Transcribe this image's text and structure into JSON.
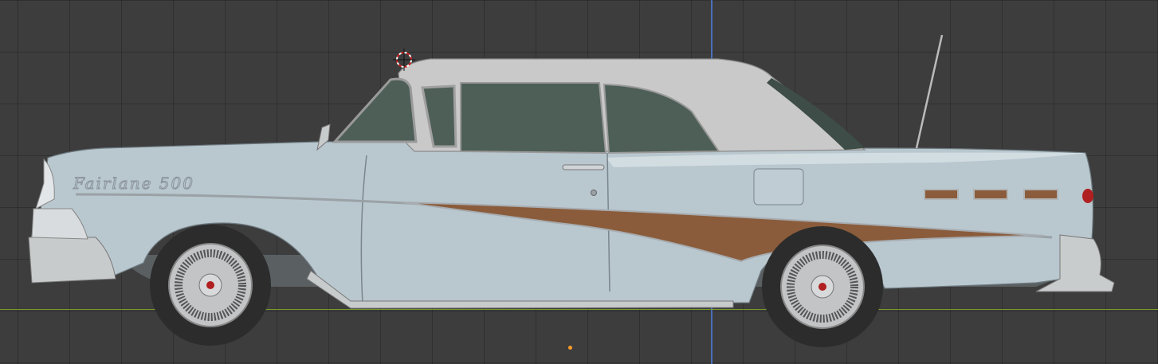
{
  "viewport": {
    "grid_color": "#2a2a2a",
    "background_color": "#3d3d3d",
    "axis_x_color": "#7a9a2a",
    "axis_z_color": "#4a6fb8",
    "origin_color": "#ff9d2a"
  },
  "model": {
    "badge_text": "Fairlane 500",
    "body_color": "#b9c7cf",
    "roof_color": "#c9c9c9",
    "glass_color": "#4e5f58",
    "trim_color": "#8a5c3b",
    "icons": [
      "3d-cursor-icon",
      "object-origin-icon"
    ]
  }
}
